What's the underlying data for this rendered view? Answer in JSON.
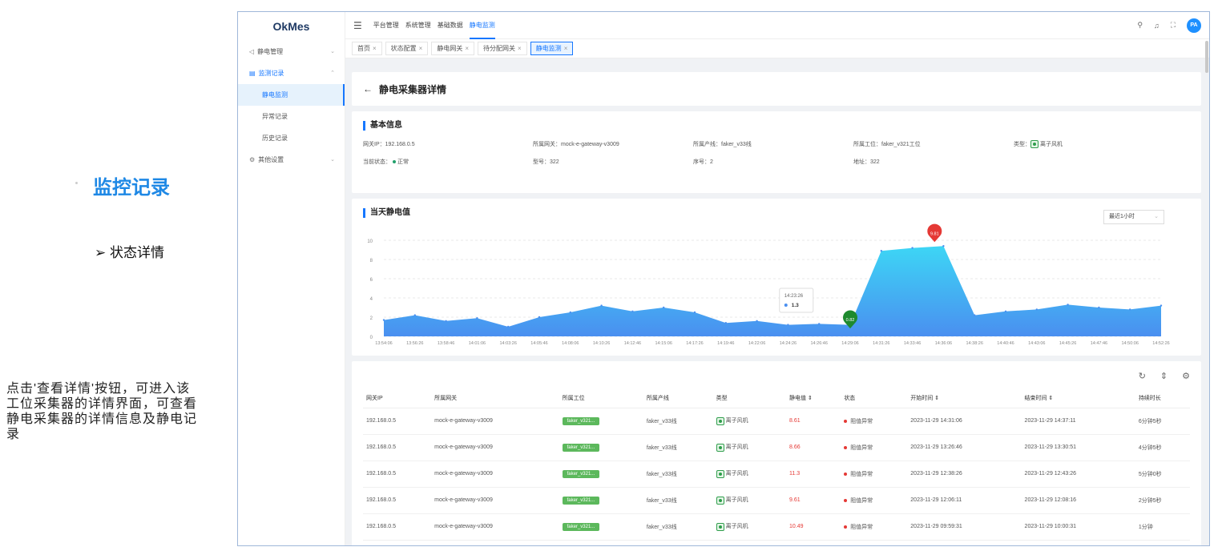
{
  "annotation": {
    "title": "监控记录",
    "subtitle": "➢ 状态详情",
    "description": "点击'查看详情'按钮，可进入该工位采集器的详情界面，可查看静电采集器的详情信息及静电记录"
  },
  "app": {
    "logo": "OkMes",
    "sidebar": {
      "items": [
        {
          "label": "静电管理",
          "icon": "◁"
        },
        {
          "label": "监测记录",
          "icon": "▤"
        },
        {
          "label": "静电监测"
        },
        {
          "label": "异常记录"
        },
        {
          "label": "历史记录"
        },
        {
          "label": "其他设置",
          "icon": "⚙"
        }
      ]
    },
    "topnav": [
      "平台管理",
      "系统管理",
      "基础数据",
      "静电监测"
    ],
    "avatar_text": "PA",
    "tabs": [
      "首页",
      "状态配置",
      "静电网关",
      "待分配网关",
      "静电监测"
    ],
    "detail_title": "静电采集器详情",
    "basic": {
      "section_title": "基本信息",
      "row1": [
        "网关IP：192.168.0.5",
        "所属网关：mock-e-gateway-v3009",
        "所属产线：faker_v33线",
        "所属工位：faker_v321工位",
        "类型：",
        "离子风机"
      ],
      "row2": [
        "当前状态：",
        "正常",
        "型号：322",
        "序号：2",
        "地址：322"
      ]
    },
    "chart_section_title": "当天静电值",
    "range_select": "最近1小时",
    "table_headers": [
      "网关IP",
      "所属网关",
      "所属工位",
      "所属产线",
      "类型",
      "静电值 ⇕",
      "状态",
      "开始时间 ⇕",
      "结束时间 ⇕",
      "持续时长"
    ],
    "table_rows": [
      [
        "192.168.0.5",
        "mock-e-gateway-v3009",
        "faker_v321...",
        "faker_v33线",
        "离子风机",
        "8.61",
        "阻值异常",
        "2023-11-29 14:31:06",
        "2023-11-29 14:37:11",
        "6分钟5秒"
      ],
      [
        "192.168.0.5",
        "mock-e-gateway-v3009",
        "faker_v321...",
        "faker_v33线",
        "离子风机",
        "8.66",
        "阻值异常",
        "2023-11-29 13:26:46",
        "2023-11-29 13:30:51",
        "4分钟5秒"
      ],
      [
        "192.168.0.5",
        "mock-e-gateway-v3009",
        "faker_v321...",
        "faker_v33线",
        "离子风机",
        "11.3",
        "阻值异常",
        "2023-11-29 12:38:26",
        "2023-11-29 12:43:26",
        "5分钟0秒"
      ],
      [
        "192.168.0.5",
        "mock-e-gateway-v3009",
        "faker_v321...",
        "faker_v33线",
        "离子风机",
        "9.61",
        "阻值异常",
        "2023-11-29 12:06:11",
        "2023-11-29 12:08:16",
        "2分钟5秒"
      ],
      [
        "192.168.0.5",
        "mock-e-gateway-v3009",
        "faker_v321...",
        "faker_v33线",
        "离子风机",
        "10.49",
        "阻值异常",
        "2023-11-29 09:59:31",
        "2023-11-29 10:00:31",
        "1分钟"
      ]
    ]
  },
  "chart_data": {
    "type": "area",
    "x": [
      "13:54:06",
      "13:56:26",
      "13:58:46",
      "14:01:06",
      "14:03:26",
      "14:05:46",
      "14:08:06",
      "14:10:26",
      "14:12:46",
      "14:15:06",
      "14:17:26",
      "14:19:46",
      "14:22:06",
      "14:24:26",
      "14:26:46",
      "14:29:06",
      "14:31:26",
      "14:33:46",
      "14:36:06",
      "14:38:26",
      "14:40:46",
      "14:43:06",
      "14:45:26",
      "14:47:46",
      "14:50:06",
      "14:52:26"
    ],
    "series": [
      {
        "values": [
          1.7,
          2.2,
          1.6,
          1.9,
          1.0,
          2.0,
          2.5,
          3.2,
          2.6,
          3.0,
          2.5,
          1.4,
          1.6,
          1.2,
          1.3,
          1.2,
          8.9,
          9.2,
          9.4,
          2.2,
          2.6,
          2.8,
          3.3,
          3.0,
          2.8,
          3.2
        ]
      }
    ],
    "ylim": [
      0,
      10
    ],
    "yticks": [
      0,
      2,
      4,
      6,
      8,
      10
    ],
    "markers": [
      {
        "label": "9.81",
        "x": "14:35:26",
        "y": 9.81,
        "color": "#e53935"
      },
      {
        "label": "0.82",
        "x": "14:29:06",
        "y": 0.82,
        "color": "#1e8a2e"
      }
    ],
    "tooltip": {
      "time": "14:23:26",
      "value": "1.3"
    },
    "colors": {
      "top": "#3dd6f5",
      "bottom": "#4a8ff0"
    }
  }
}
